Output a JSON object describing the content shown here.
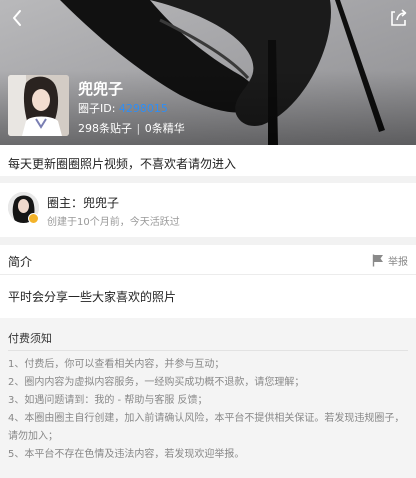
{
  "circle": {
    "name": "兜兜子",
    "id_label": "圈子ID:",
    "id_value": "4298015",
    "posts": "298条贴子",
    "separator": "|",
    "featured": "0条精华",
    "description": "每天更新圈圈照片视频，不喜欢者请勿进入"
  },
  "owner": {
    "line": "圈主：兜兜子",
    "meta": "创建于10个月前，今天活跃过"
  },
  "intro": {
    "title": "简介",
    "report": "举报",
    "text": "平时会分享一些大家喜欢的照片"
  },
  "notice": {
    "title": "付费须知",
    "items": [
      "1、付费后，你可以查看相关内容，并参与互动；",
      "2、圈内内容为虚拟内容服务，一经购买成功概不退款，请您理解；",
      "3、如遇问题请到：我的 - 帮助与客服 反馈；",
      "4、本圈由圈主自行创建，加入前请确认风险，本平台不提供相关保证。若发现违规圈子，请勿加入；",
      "5、本平台不存在色情及违法内容，若发现欢迎举报。"
    ]
  },
  "icons": {
    "back": "chevron-left-icon",
    "share": "share-icon",
    "report": "flag-icon",
    "badge": "owner-badge-icon"
  },
  "colors": {
    "id_accent": "#2f8ef5",
    "badge": "#f3b32a",
    "section_gap": "#f2f2f2"
  }
}
